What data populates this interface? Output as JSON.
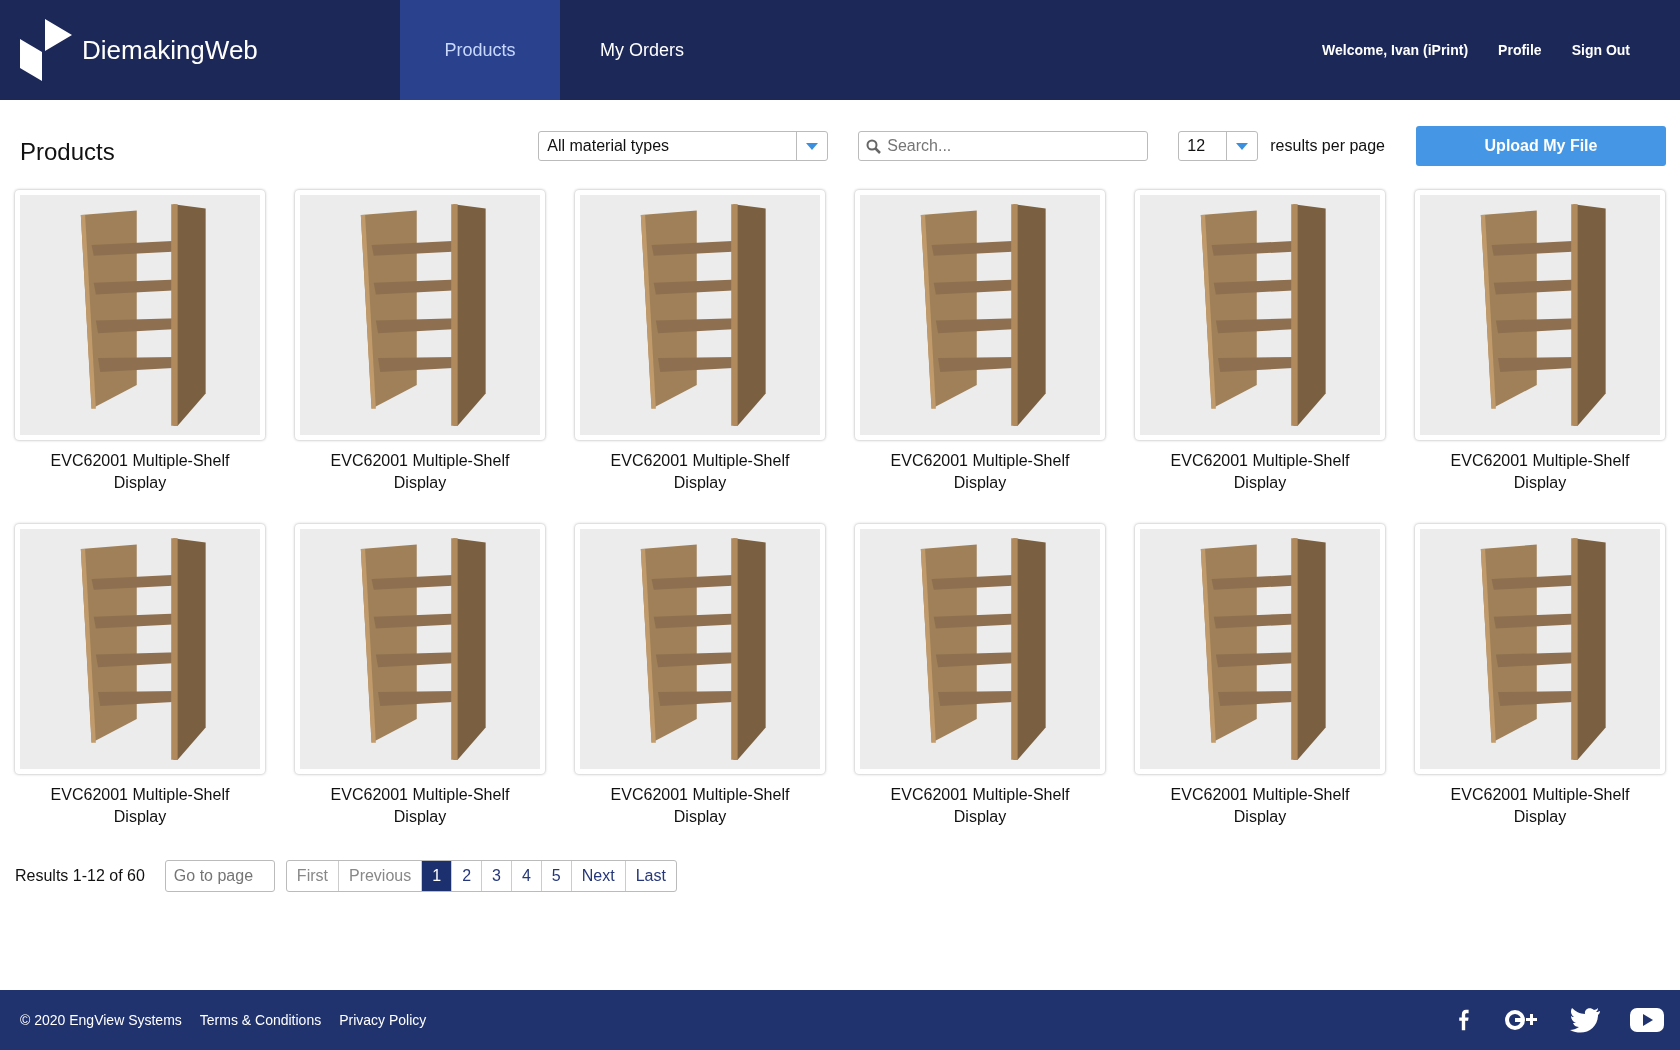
{
  "header": {
    "brand": "DiemakingWeb",
    "nav": [
      {
        "label": "Products",
        "selected": true
      },
      {
        "label": "My Orders",
        "selected": false
      }
    ],
    "welcome": "Welcome, Ivan (iPrint)",
    "links": [
      "Profile",
      "Sign Out"
    ]
  },
  "toolbar": {
    "title": "Products",
    "material_filter": {
      "value": "All material types"
    },
    "search": {
      "placeholder": "Search..."
    },
    "per_page": {
      "value": "12",
      "label": "results per page"
    },
    "upload_button": "Upload My File"
  },
  "products": [
    {
      "name": "EVC62001 Multiple-Shelf Display"
    },
    {
      "name": "EVC62001 Multiple-Shelf Display"
    },
    {
      "name": "EVC62001 Multiple-Shelf Display"
    },
    {
      "name": "EVC62001 Multiple-Shelf Display"
    },
    {
      "name": "EVC62001 Multiple-Shelf Display"
    },
    {
      "name": "EVC62001 Multiple-Shelf Display"
    },
    {
      "name": "EVC62001 Multiple-Shelf Display"
    },
    {
      "name": "EVC62001 Multiple-Shelf Display"
    },
    {
      "name": "EVC62001 Multiple-Shelf Display"
    },
    {
      "name": "EVC62001 Multiple-Shelf Display"
    },
    {
      "name": "EVC62001 Multiple-Shelf Display"
    },
    {
      "name": "EVC62001 Multiple-Shelf Display"
    }
  ],
  "pagination": {
    "results": "Results 1-12 of 60",
    "go_to_page": {
      "placeholder": "Go to page"
    },
    "pages": [
      {
        "label": "First",
        "selected": false,
        "disabled": true
      },
      {
        "label": "Previous",
        "selected": false,
        "disabled": true
      },
      {
        "label": "1",
        "selected": true,
        "disabled": false
      },
      {
        "label": "2",
        "selected": false,
        "disabled": false
      },
      {
        "label": "3",
        "selected": false,
        "disabled": false
      },
      {
        "label": "4",
        "selected": false,
        "disabled": false
      },
      {
        "label": "5",
        "selected": false,
        "disabled": false
      },
      {
        "label": "Next",
        "selected": false,
        "disabled": false
      },
      {
        "label": "Last",
        "selected": false,
        "disabled": false
      }
    ]
  },
  "footer": {
    "copyright": "© 2020 EngView Systems",
    "links": [
      "Terms & Conditions",
      "Privacy Policy"
    ],
    "social": [
      {
        "kind": "facebook"
      },
      {
        "kind": "googleplus"
      },
      {
        "kind": "twitter"
      },
      {
        "kind": "youtube"
      }
    ]
  }
}
